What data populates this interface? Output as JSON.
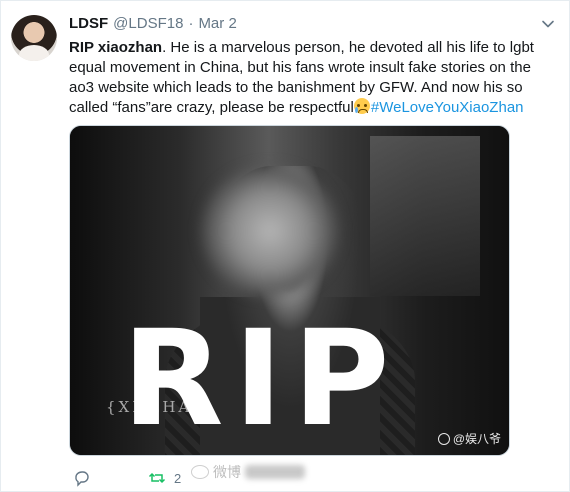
{
  "tweet": {
    "display_name": "LDSF",
    "handle": "@LDSF18",
    "separator": "·",
    "date": "Mar 2",
    "text_bold": "RIP xiaozhan",
    "text_body": ". He is a marvelous person, he devoted all his life to lgbt equal movement in China, but his fans wrote insult fake stories on the ao3 website which leads to the banishment by GFW. And now his so called “fans”are crazy, please be respectful",
    "hashtag": "#WeLoveYouXiaoZhan",
    "emoji": "crying-face-emoji"
  },
  "media": {
    "overlay_text": "RIP",
    "faint_text": "{XI    ZHA  }",
    "watermark": "@娱八爷"
  },
  "actions": {
    "retweet_count": "2"
  },
  "watermark_bottom": {
    "label": "微博"
  },
  "colors": {
    "link": "#1b95e0",
    "retweet": "#17bf63",
    "secondary": "#657786"
  }
}
